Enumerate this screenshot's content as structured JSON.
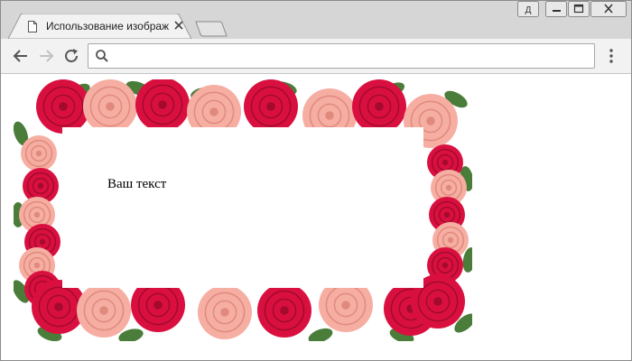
{
  "tab": {
    "title": "Использование изображени"
  },
  "omnibox": {
    "value": ""
  },
  "window_buttons": {
    "user_label": "Д"
  },
  "page": {
    "text": "Ваш текст"
  },
  "icons": {
    "tab": "document-icon",
    "close": "close-icon",
    "back": "back-arrow-icon",
    "forward": "forward-arrow-icon",
    "reload": "reload-icon",
    "search": "search-icon",
    "menu": "kebab-menu-icon"
  },
  "colors": {
    "titlebar": "#d6d6d6",
    "toolbar": "#f2f2f2",
    "rose_red": "#d9103f",
    "rose_pink": "#f6aea2",
    "leaf_green": "#4a7c3a"
  }
}
